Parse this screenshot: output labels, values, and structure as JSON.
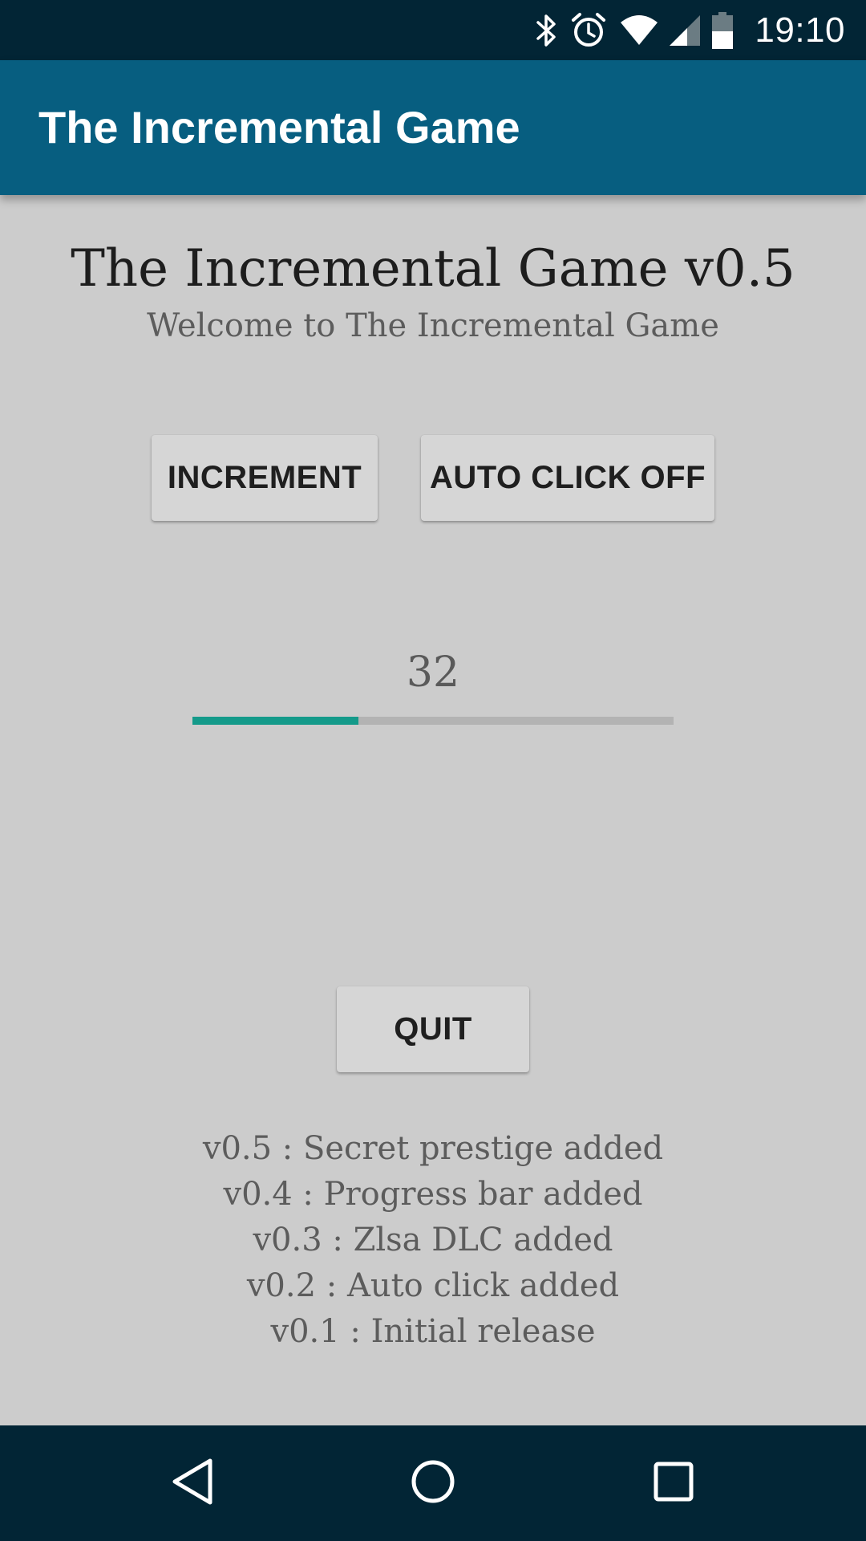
{
  "status_bar": {
    "time": "19:10",
    "icons": [
      "bluetooth-icon",
      "alarm-icon",
      "wifi-icon",
      "signal-icon",
      "battery-icon"
    ]
  },
  "app_bar": {
    "title": "The Incremental Game",
    "color": "#075e80"
  },
  "main": {
    "game_title": "The Incremental Game v0.5",
    "welcome": "Welcome to The Incremental Game",
    "increment_label": "INCREMENT",
    "auto_click_label": "AUTO CLICK OFF",
    "counter": "32",
    "progress": 0.345,
    "progress_color": "#149a8a",
    "quit_label": "QUIT",
    "changelog": [
      "v0.5 : Secret prestige added",
      "v0.4 : Progress bar added",
      "v0.3 : Zlsa DLC added",
      "v0.2 : Auto click added",
      "v0.1 : Initial release"
    ]
  },
  "nav_bar": {
    "icons": [
      "back-icon",
      "home-icon",
      "recents-icon"
    ]
  }
}
